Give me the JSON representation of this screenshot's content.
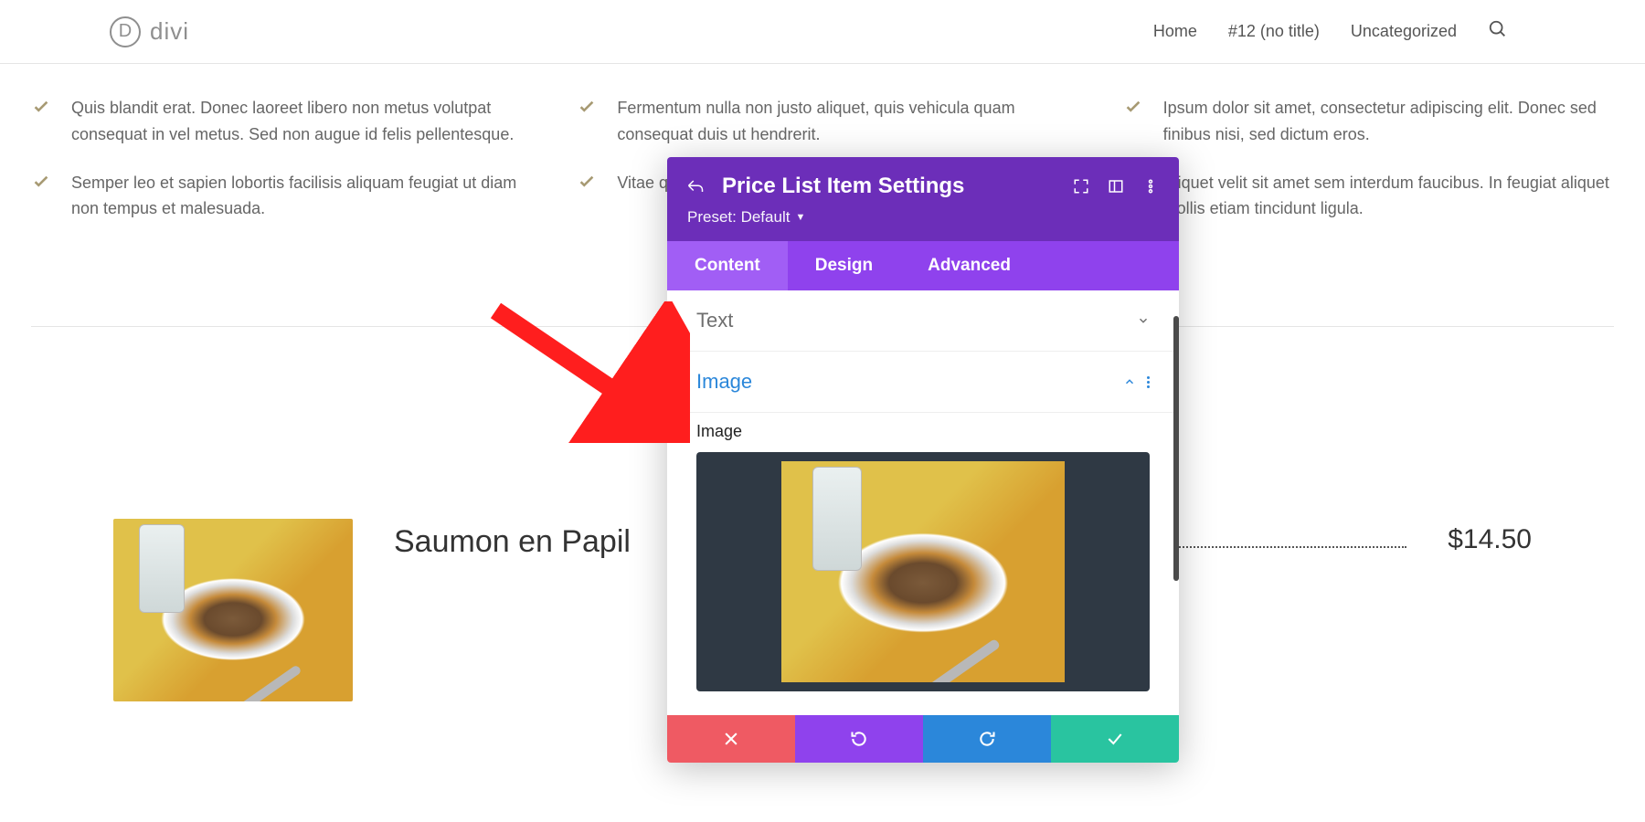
{
  "header": {
    "logo_letter": "D",
    "logo_text": "divi",
    "nav": {
      "home": "Home",
      "item12": "#12 (no title)",
      "uncategorized": "Uncategorized"
    }
  },
  "features": {
    "col1": [
      "Quis blandit erat. Donec laoreet libero non metus volutpat consequat in vel metus. Sed non augue id felis pellentesque.",
      "Semper leo et sapien lobortis facilisis aliquam feugiat ut diam non tempus et malesuada."
    ],
    "col2": [
      "Fermentum nulla non justo aliquet, quis vehicula quam consequat duis ut hendrerit.",
      "Vitae quam urna"
    ],
    "col3": [
      "Ipsum dolor sit amet, consectetur adipiscing elit. Donec sed finibus nisi, sed dictum eros.",
      "Aliquet velit sit amet sem interdum faucibus. In feugiat aliquet mollis etiam tincidunt ligula."
    ]
  },
  "price_item": {
    "title": "Saumon en Papil",
    "price": "$14.50"
  },
  "modal": {
    "title": "Price List Item Settings",
    "preset_label": "Preset: Default",
    "tabs": {
      "content": "Content",
      "design": "Design",
      "advanced": "Advanced"
    },
    "sections": {
      "text": "Text",
      "image": "Image"
    },
    "fields": {
      "image_label": "Image"
    }
  }
}
